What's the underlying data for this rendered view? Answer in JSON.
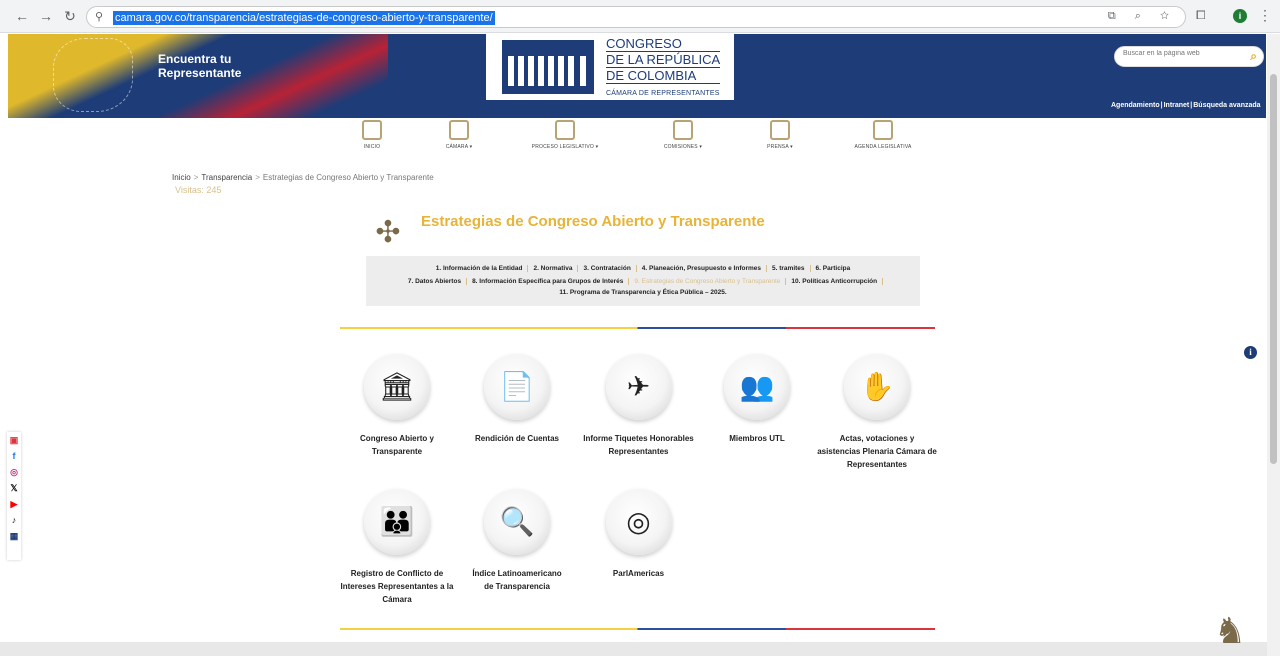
{
  "browser": {
    "url": "camara.gov.co/transparencia/estrategias-de-congreso-abierto-y-transparente/",
    "profile_initial": "i"
  },
  "header": {
    "find_rep": "Encuentra tu Representante",
    "logo_line1": "CONGRESO",
    "logo_line2": "DE LA REPÚBLICA",
    "logo_line3": "DE COLOMBIA",
    "logo_sub": "CÁMARA DE REPRESENTANTES",
    "search_placeholder": "Buscar en la página web",
    "links": [
      "Agendamiento",
      "Intranet",
      "Búsqueda avanzada"
    ]
  },
  "nav": [
    {
      "label": "INICIO",
      "icon": "home-icon"
    },
    {
      "label": "CÁMARA ▾",
      "icon": "building-icon"
    },
    {
      "label": "PROCESO LEGISLATIVO ▾",
      "icon": "document-icon"
    },
    {
      "label": "COMISIONES ▾",
      "icon": "commissions-icon"
    },
    {
      "label": "PRENSA ▾",
      "icon": "press-icon"
    },
    {
      "label": "AGENDA LEGISLATIVA",
      "icon": "agenda-icon"
    }
  ],
  "breadcrumb": {
    "home": "Inicio",
    "section": "Transparencia",
    "current": "Estrategias de Congreso Abierto y Transparente",
    "visits": "Visitas: 245"
  },
  "page_title": "Estrategias de Congreso Abierto y Transparente",
  "tabs": {
    "row1": [
      "1. Información de la Entidad",
      "2. Normativa",
      "3. Contratación",
      "4. Planeación, Presupuesto e Informes",
      "5. tramites",
      "6. Participa"
    ],
    "row2": [
      "7. Datos Abiertos",
      "8. Información Específica para Grupos de Interés",
      "9. Estrategias de Congreso Abierto y Transparente",
      "10. Políticas Anticorrupción"
    ],
    "row3": [
      "11. Programa de Transparencia y Ética Pública – 2025."
    ]
  },
  "cards": [
    {
      "label": "Congreso Abierto y Transparente",
      "icon": "capitol-icon"
    },
    {
      "label": "Rendición de Cuentas",
      "icon": "report-magnifier-icon"
    },
    {
      "label": "Informe Tiquetes Honorables Representantes",
      "icon": "airplane-icon"
    },
    {
      "label": "Miembros UTL",
      "icon": "team-icon"
    },
    {
      "label": "Actas, votaciones y asistencias Plenaria Cámara de Representantes",
      "icon": "vote-hand-icon"
    },
    {
      "label": "Registro de Conflicto de Intereses Representantes a la Cámara",
      "icon": "people-group-icon"
    },
    {
      "label": "Índice Latinoamericano de Transparencia",
      "icon": "magnifier-building-icon"
    },
    {
      "label": "ParlAmericas",
      "icon": "parlamericas-logo-icon"
    }
  ],
  "social": [
    "tv-icon",
    "facebook-icon",
    "instagram-icon",
    "x-icon",
    "youtube-icon",
    "tiktok-icon",
    "app-icon"
  ],
  "colors": {
    "navy": "#1d3c78",
    "gold": "#e7b438",
    "yellow": "#f5d142",
    "blue": "#2b4fa1",
    "red": "#d9353b"
  }
}
